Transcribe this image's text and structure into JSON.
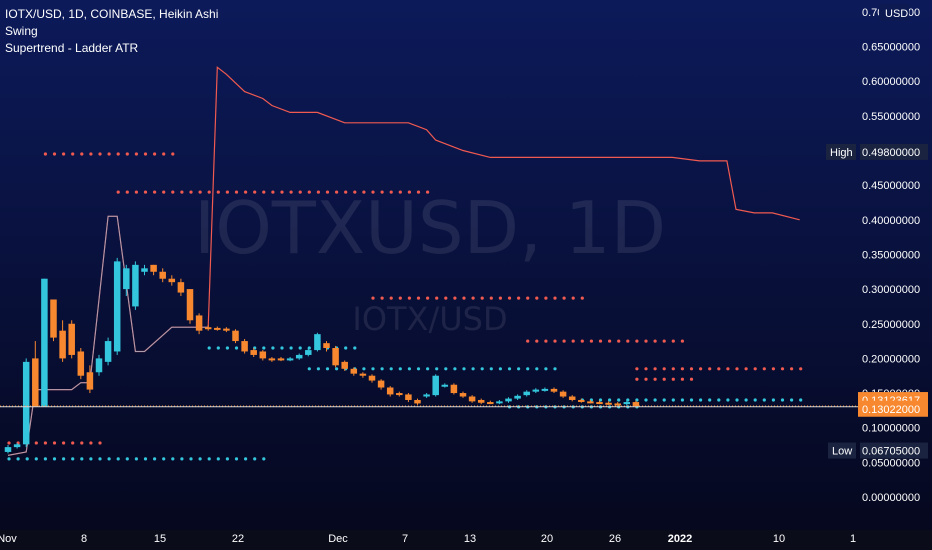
{
  "header": {
    "symbol_line": "IOTX/USD, 1D, COINBASE, Heikin Ashi",
    "indicator_1": "Swing",
    "indicator_2": "Supertrend - Ladder ATR"
  },
  "watermark": {
    "main": "IOTXUSD, 1D",
    "sub": "IOTX/USD"
  },
  "price_axis": {
    "currency": "USD",
    "tick_labels": [
      "0.70000000",
      "0.65000000",
      "0.60000000",
      "0.55000000",
      "0.50000000",
      "0.45000000",
      "0.40000000",
      "0.35000000",
      "0.30000000",
      "0.25000000",
      "0.20000000",
      "0.15000000",
      "0.10000000",
      "0.05000000",
      "0.00000000"
    ]
  },
  "time_axis": {
    "labels": [
      "Nov",
      "8",
      "15",
      "22",
      "Dec",
      "7",
      "13",
      "20",
      "26",
      "2022",
      "10",
      "1"
    ]
  },
  "badges": {
    "high": {
      "label": "High",
      "value": "0.49800000"
    },
    "low": {
      "label": "Low",
      "value": "0.06705000"
    },
    "last_price": "0.13123617",
    "line_price": "0.13022000"
  },
  "colors": {
    "background_top": "#0c1a5a",
    "background_bottom": "#05071c",
    "up_candle": "#33c6dc",
    "down_candle": "#f7882f",
    "swing_line": "#f05a50",
    "support_dots": "#33c6dc",
    "resistance_dots": "#f05a50"
  },
  "chart_data": {
    "type": "candlestick",
    "chart_style": "Heikin Ashi",
    "y_scale": "linear",
    "ylim": [
      -0.04,
      0.7
    ],
    "x_labels": [
      "Nov",
      "8",
      "15",
      "22",
      "Dec",
      "7",
      "13",
      "20",
      "26",
      "2022",
      "10",
      "1"
    ],
    "candles": [
      {
        "day": 0,
        "open": 0.065,
        "close": 0.072,
        "high": 0.075,
        "low": 0.063
      },
      {
        "day": 1,
        "open": 0.072,
        "close": 0.076,
        "high": 0.078,
        "low": 0.07
      },
      {
        "day": 2,
        "open": 0.076,
        "close": 0.195,
        "high": 0.2,
        "low": 0.072
      },
      {
        "day": 3,
        "open": 0.2,
        "close": 0.13,
        "high": 0.225,
        "low": 0.13
      },
      {
        "day": 4,
        "open": 0.13,
        "close": 0.315,
        "high": 0.315,
        "low": 0.13
      },
      {
        "day": 5,
        "open": 0.285,
        "close": 0.23,
        "high": 0.285,
        "low": 0.225
      },
      {
        "day": 6,
        "open": 0.24,
        "close": 0.2,
        "high": 0.255,
        "low": 0.195
      },
      {
        "day": 7,
        "open": 0.25,
        "close": 0.205,
        "high": 0.255,
        "low": 0.2
      },
      {
        "day": 8,
        "open": 0.21,
        "close": 0.175,
        "high": 0.215,
        "low": 0.17
      },
      {
        "day": 9,
        "open": 0.18,
        "close": 0.155,
        "high": 0.19,
        "low": 0.15
      },
      {
        "day": 10,
        "open": 0.18,
        "close": 0.2,
        "high": 0.205,
        "low": 0.175
      },
      {
        "day": 11,
        "open": 0.195,
        "close": 0.225,
        "high": 0.23,
        "low": 0.19
      },
      {
        "day": 12,
        "open": 0.21,
        "close": 0.34,
        "high": 0.345,
        "low": 0.205
      },
      {
        "day": 13,
        "open": 0.3,
        "close": 0.33,
        "high": 0.335,
        "low": 0.29
      },
      {
        "day": 14,
        "open": 0.275,
        "close": 0.335,
        "high": 0.34,
        "low": 0.27
      },
      {
        "day": 15,
        "open": 0.325,
        "close": 0.33,
        "high": 0.335,
        "low": 0.32
      },
      {
        "day": 16,
        "open": 0.335,
        "close": 0.325,
        "high": 0.335,
        "low": 0.32
      },
      {
        "day": 17,
        "open": 0.325,
        "close": 0.315,
        "high": 0.33,
        "low": 0.31
      },
      {
        "day": 18,
        "open": 0.315,
        "close": 0.31,
        "high": 0.32,
        "low": 0.305
      },
      {
        "day": 19,
        "open": 0.31,
        "close": 0.295,
        "high": 0.315,
        "low": 0.29
      },
      {
        "day": 20,
        "open": 0.3,
        "close": 0.255,
        "high": 0.3,
        "low": 0.25
      },
      {
        "day": 21,
        "open": 0.262,
        "close": 0.24,
        "high": 0.265,
        "low": 0.235
      },
      {
        "day": 22,
        "open": 0.245,
        "close": 0.243,
        "high": 0.248,
        "low": 0.24
      },
      {
        "day": 23,
        "open": 0.244,
        "close": 0.242,
        "high": 0.246,
        "low": 0.24
      },
      {
        "day": 24,
        "open": 0.243,
        "close": 0.24,
        "high": 0.245,
        "low": 0.238
      },
      {
        "day": 25,
        "open": 0.24,
        "close": 0.225,
        "high": 0.242,
        "low": 0.222
      },
      {
        "day": 26,
        "open": 0.225,
        "close": 0.21,
        "high": 0.228,
        "low": 0.207
      },
      {
        "day": 27,
        "open": 0.212,
        "close": 0.205,
        "high": 0.215,
        "low": 0.202
      },
      {
        "day": 28,
        "open": 0.21,
        "close": 0.2,
        "high": 0.212,
        "low": 0.197
      },
      {
        "day": 29,
        "open": 0.2,
        "close": 0.198,
        "high": 0.202,
        "low": 0.195
      },
      {
        "day": 30,
        "open": 0.2,
        "close": 0.198,
        "high": 0.202,
        "low": 0.196
      },
      {
        "day": 31,
        "open": 0.199,
        "close": 0.2,
        "high": 0.202,
        "low": 0.196
      },
      {
        "day": 32,
        "open": 0.2,
        "close": 0.205,
        "high": 0.207,
        "low": 0.198
      },
      {
        "day": 33,
        "open": 0.205,
        "close": 0.212,
        "high": 0.215,
        "low": 0.203
      },
      {
        "day": 34,
        "open": 0.212,
        "close": 0.235,
        "high": 0.237,
        "low": 0.21
      },
      {
        "day": 35,
        "open": 0.222,
        "close": 0.215,
        "high": 0.225,
        "low": 0.21
      },
      {
        "day": 36,
        "open": 0.215,
        "close": 0.19,
        "high": 0.218,
        "low": 0.187
      },
      {
        "day": 37,
        "open": 0.195,
        "close": 0.185,
        "high": 0.197,
        "low": 0.182
      },
      {
        "day": 38,
        "open": 0.185,
        "close": 0.178,
        "high": 0.187,
        "low": 0.175
      },
      {
        "day": 39,
        "open": 0.178,
        "close": 0.175,
        "high": 0.18,
        "low": 0.172
      },
      {
        "day": 40,
        "open": 0.175,
        "close": 0.168,
        "high": 0.177,
        "low": 0.165
      },
      {
        "day": 41,
        "open": 0.168,
        "close": 0.158,
        "high": 0.17,
        "low": 0.155
      },
      {
        "day": 42,
        "open": 0.158,
        "close": 0.148,
        "high": 0.16,
        "low": 0.145
      },
      {
        "day": 43,
        "open": 0.15,
        "close": 0.148,
        "high": 0.152,
        "low": 0.145
      },
      {
        "day": 44,
        "open": 0.148,
        "close": 0.14,
        "high": 0.15,
        "low": 0.137
      },
      {
        "day": 45,
        "open": 0.14,
        "close": 0.135,
        "high": 0.142,
        "low": 0.133
      },
      {
        "day": 46,
        "open": 0.145,
        "close": 0.148,
        "high": 0.15,
        "low": 0.143
      },
      {
        "day": 47,
        "open": 0.147,
        "close": 0.175,
        "high": 0.177,
        "low": 0.145
      },
      {
        "day": 48,
        "open": 0.16,
        "close": 0.162,
        "high": 0.164,
        "low": 0.158
      },
      {
        "day": 49,
        "open": 0.162,
        "close": 0.15,
        "high": 0.164,
        "low": 0.148
      },
      {
        "day": 50,
        "open": 0.15,
        "close": 0.145,
        "high": 0.152,
        "low": 0.143
      },
      {
        "day": 51,
        "open": 0.145,
        "close": 0.138,
        "high": 0.147,
        "low": 0.136
      },
      {
        "day": 52,
        "open": 0.14,
        "close": 0.136,
        "high": 0.142,
        "low": 0.134
      },
      {
        "day": 53,
        "open": 0.137,
        "close": 0.136,
        "high": 0.139,
        "low": 0.134
      },
      {
        "day": 54,
        "open": 0.136,
        "close": 0.138,
        "high": 0.14,
        "low": 0.134
      },
      {
        "day": 55,
        "open": 0.138,
        "close": 0.142,
        "high": 0.144,
        "low": 0.136
      },
      {
        "day": 56,
        "open": 0.142,
        "close": 0.146,
        "high": 0.148,
        "low": 0.14
      },
      {
        "day": 57,
        "open": 0.147,
        "close": 0.152,
        "high": 0.154,
        "low": 0.145
      },
      {
        "day": 58,
        "open": 0.152,
        "close": 0.155,
        "high": 0.157,
        "low": 0.15
      },
      {
        "day": 59,
        "open": 0.154,
        "close": 0.156,
        "high": 0.158,
        "low": 0.152
      },
      {
        "day": 60,
        "open": 0.156,
        "close": 0.152,
        "high": 0.158,
        "low": 0.15
      },
      {
        "day": 61,
        "open": 0.152,
        "close": 0.145,
        "high": 0.154,
        "low": 0.143
      },
      {
        "day": 62,
        "open": 0.145,
        "close": 0.14,
        "high": 0.147,
        "low": 0.138
      },
      {
        "day": 63,
        "open": 0.14,
        "close": 0.138,
        "high": 0.142,
        "low": 0.136
      },
      {
        "day": 64,
        "open": 0.138,
        "close": 0.137,
        "high": 0.14,
        "low": 0.135
      },
      {
        "day": 65,
        "open": 0.137,
        "close": 0.136,
        "high": 0.139,
        "low": 0.134
      },
      {
        "day": 66,
        "open": 0.136,
        "close": 0.135,
        "high": 0.138,
        "low": 0.133
      },
      {
        "day": 67,
        "open": 0.135,
        "close": 0.134,
        "high": 0.137,
        "low": 0.132
      },
      {
        "day": 68,
        "open": 0.134,
        "close": 0.137,
        "high": 0.139,
        "low": 0.132
      },
      {
        "day": 69,
        "open": 0.137,
        "close": 0.131,
        "high": 0.139,
        "low": 0.129
      }
    ],
    "swing_line": [
      {
        "day": 0,
        "value": 0.06
      },
      {
        "day": 2,
        "value": 0.065
      },
      {
        "day": 3,
        "value": 0.155
      },
      {
        "day": 7,
        "value": 0.155
      },
      {
        "day": 8,
        "value": 0.165
      },
      {
        "day": 9,
        "value": 0.165
      },
      {
        "day": 11,
        "value": 0.405
      },
      {
        "day": 12,
        "value": 0.405
      },
      {
        "day": 14,
        "value": 0.21
      },
      {
        "day": 15,
        "value": 0.21
      },
      {
        "day": 18,
        "value": 0.245
      },
      {
        "day": 22,
        "value": 0.245
      },
      {
        "day": 23,
        "value": 0.62
      },
      {
        "day": 24,
        "value": 0.61
      },
      {
        "day": 26,
        "value": 0.585
      },
      {
        "day": 28,
        "value": 0.575
      },
      {
        "day": 29,
        "value": 0.565
      },
      {
        "day": 31,
        "value": 0.555
      },
      {
        "day": 34,
        "value": 0.555
      },
      {
        "day": 37,
        "value": 0.54
      },
      {
        "day": 44,
        "value": 0.54
      },
      {
        "day": 46,
        "value": 0.53
      },
      {
        "day": 47,
        "value": 0.515
      },
      {
        "day": 50,
        "value": 0.5
      },
      {
        "day": 53,
        "value": 0.49
      },
      {
        "day": 73,
        "value": 0.49
      },
      {
        "day": 76,
        "value": 0.485
      },
      {
        "day": 79,
        "value": 0.485
      },
      {
        "day": 80,
        "value": 0.415
      },
      {
        "day": 82,
        "value": 0.41
      },
      {
        "day": 84,
        "value": 0.41
      },
      {
        "day": 87,
        "value": 0.4
      }
    ],
    "resistance_levels": [
      {
        "value": 0.078,
        "from": 0,
        "to": 10
      },
      {
        "value": 0.495,
        "from": 4,
        "to": 18
      },
      {
        "value": 0.44,
        "from": 12,
        "to": 46
      },
      {
        "value": 0.287,
        "from": 40,
        "to": 63
      },
      {
        "value": 0.225,
        "from": 57,
        "to": 74
      },
      {
        "value": 0.185,
        "from": 69,
        "to": 87
      },
      {
        "value": 0.17,
        "from": 69,
        "to": 75
      }
    ],
    "support_levels": [
      {
        "value": 0.055,
        "from": 0,
        "to": 28
      },
      {
        "value": 0.215,
        "from": 22,
        "to": 38
      },
      {
        "value": 0.185,
        "from": 33,
        "to": 60
      },
      {
        "value": 0.13,
        "from": 55,
        "to": 69
      },
      {
        "value": 0.14,
        "from": 63,
        "to": 87
      }
    ]
  }
}
